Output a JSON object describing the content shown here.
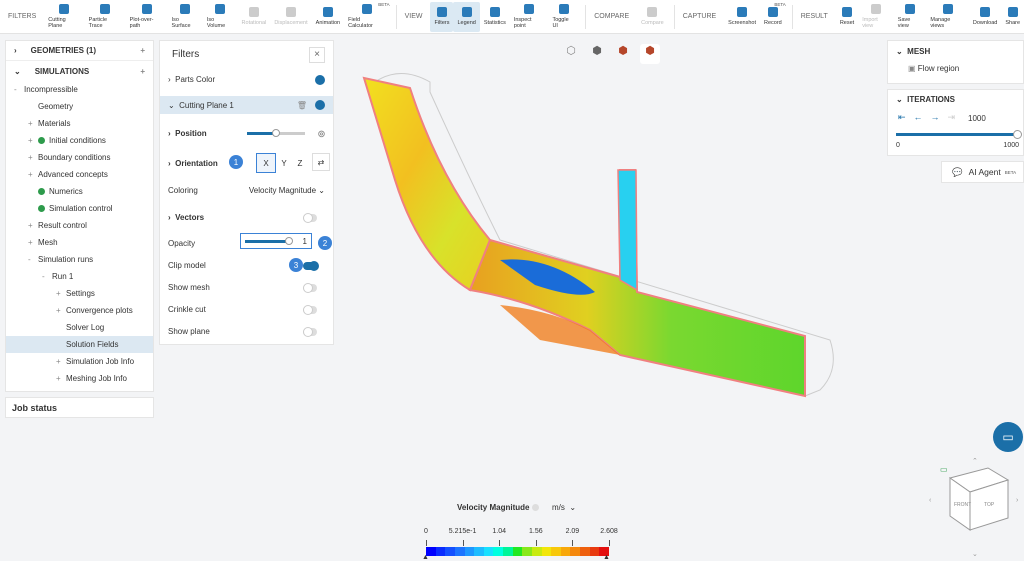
{
  "toolbar": {
    "filters_label": "FILTERS",
    "filters": [
      {
        "label": "Cutting Plane"
      },
      {
        "label": "Particle Trace"
      },
      {
        "label": "Plot-over-path"
      },
      {
        "label": "Iso Surface"
      },
      {
        "label": "Iso Volume"
      },
      {
        "label": "Rotational",
        "disabled": true
      },
      {
        "label": "Displacement",
        "disabled": true
      },
      {
        "label": "Animation"
      },
      {
        "label": "Field Calculator",
        "badge": "BETA"
      }
    ],
    "view_label": "VIEW",
    "view": [
      {
        "label": "Filters",
        "active": true
      },
      {
        "label": "Legend",
        "active": true
      },
      {
        "label": "Statistics"
      },
      {
        "label": "Inspect point"
      },
      {
        "label": "Toggle UI"
      }
    ],
    "compare_label": "COMPARE",
    "compare": [
      {
        "label": "Compare",
        "disabled": true
      }
    ],
    "capture_label": "CAPTURE",
    "capture": [
      {
        "label": "Screenshot"
      },
      {
        "label": "Record",
        "badge": "BETA"
      }
    ],
    "result_label": "RESULT",
    "result": [
      {
        "label": "Reset"
      },
      {
        "label": "Import view",
        "disabled": true
      },
      {
        "label": "Save view"
      },
      {
        "label": "Manage views"
      },
      {
        "label": "Download"
      },
      {
        "label": "Share"
      }
    ]
  },
  "tree": {
    "geometries": "GEOMETRIES (1)",
    "simulations": "SIMULATIONS",
    "items": [
      {
        "label": "Incompressible",
        "indent": 1,
        "pm": "-"
      },
      {
        "label": "Geometry",
        "indent": 2,
        "pm": ""
      },
      {
        "label": "Materials",
        "indent": 2,
        "pm": "+"
      },
      {
        "label": "Initial conditions",
        "indent": 2,
        "pm": "+",
        "check": true
      },
      {
        "label": "Boundary conditions",
        "indent": 2,
        "pm": "+"
      },
      {
        "label": "Advanced concepts",
        "indent": 2,
        "pm": "+"
      },
      {
        "label": "Numerics",
        "indent": 2,
        "pm": "",
        "check": true
      },
      {
        "label": "Simulation control",
        "indent": 2,
        "pm": "",
        "check": true
      },
      {
        "label": "Result control",
        "indent": 2,
        "pm": "+"
      },
      {
        "label": "Mesh",
        "indent": 2,
        "pm": "+"
      },
      {
        "label": "Simulation runs",
        "indent": 2,
        "pm": "-"
      },
      {
        "label": "Run 1",
        "indent": 3,
        "pm": "-"
      },
      {
        "label": "Settings",
        "indent": 4,
        "pm": "+"
      },
      {
        "label": "Convergence plots",
        "indent": 4,
        "pm": "+"
      },
      {
        "label": "Solver Log",
        "indent": 4,
        "pm": ""
      },
      {
        "label": "Solution Fields",
        "indent": 4,
        "pm": "",
        "selected": true
      },
      {
        "label": "Simulation Job Info",
        "indent": 4,
        "pm": "+"
      },
      {
        "label": "Meshing Job Info",
        "indent": 4,
        "pm": "+"
      }
    ],
    "job_status": "Job status"
  },
  "filters_panel": {
    "title": "Filters",
    "parts_color": "Parts Color",
    "cutting_plane": "Cutting Plane 1",
    "position": "Position",
    "orientation": "Orientation",
    "axes": [
      "X",
      "Y",
      "Z"
    ],
    "coloring_label": "Coloring",
    "coloring_value": "Velocity Magnitude",
    "vectors": "Vectors",
    "opacity_label": "Opacity",
    "opacity_value": "1",
    "clip_model": "Clip model",
    "show_mesh": "Show mesh",
    "crinkle_cut": "Crinkle cut",
    "show_plane": "Show plane",
    "badges": [
      "1",
      "2",
      "3"
    ]
  },
  "right": {
    "mesh_title": "MESH",
    "mesh_item": "Flow region",
    "iterations_title": "ITERATIONS",
    "iteration_value": "1000",
    "iter_min": "0",
    "iter_max": "1000",
    "ai_agent": "AI Agent",
    "ai_badge": "BETA"
  },
  "legend": {
    "title": "Velocity Magnitude",
    "unit": "m/s",
    "ticks": [
      "0",
      "5.215e-1",
      "1.04",
      "1.56",
      "2.09",
      "2.608"
    ],
    "colors": [
      "#0000ff",
      "#0a2cff",
      "#1450ff",
      "#1c74ff",
      "#1e98ff",
      "#1ebcff",
      "#18e0ff",
      "#00ffe0",
      "#00f59a",
      "#22e822",
      "#88e81a",
      "#c8ea10",
      "#f2e60a",
      "#f8c80a",
      "#f8a80a",
      "#f4880c",
      "#ee600e",
      "#e83a10",
      "#e41010"
    ]
  }
}
